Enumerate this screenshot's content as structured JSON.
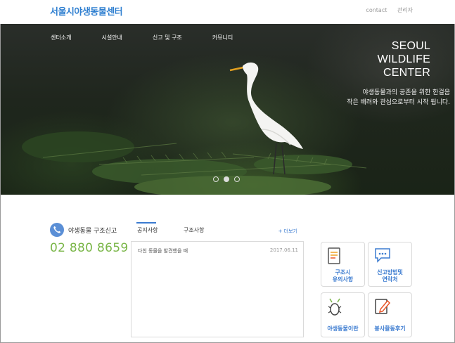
{
  "site": {
    "logo": "서울시야생동물센터"
  },
  "top_links": [
    "contact",
    "관리자"
  ],
  "nav": [
    "센터소개",
    "시설안내",
    "신고 및 구조",
    "커뮤니티"
  ],
  "hero": {
    "title_lines": [
      "SEOUL",
      "WILDLIFE",
      "CENTER"
    ],
    "subtitle_lines": [
      "야생동물과의 공존을 위한 한걸음",
      "작은 배려와 관심으로부터 시작 됩니다."
    ],
    "slides": {
      "count": 3,
      "active": 2
    }
  },
  "hotline": {
    "label": "야생동물 구조신고",
    "number": "02 880 8659",
    "icon": "phone-icon"
  },
  "board": {
    "tabs": [
      "공지사항",
      "구조사항"
    ],
    "active_tab": "공지사항",
    "more_label": "+ 더보기",
    "rows": [
      {
        "title": "다친 동물을 발견했을 때",
        "date": "2017.06.11"
      }
    ]
  },
  "quick_cards": [
    {
      "label": "구조시 유의사항",
      "icon": "document-icon"
    },
    {
      "label": "신고방법및 연락처",
      "icon": "chat-bubble-icon"
    },
    {
      "label": "야생동물이란",
      "icon": "bug-icon"
    },
    {
      "label": "봉사활동후기",
      "icon": "pencil-icon"
    }
  ],
  "colors": {
    "brand": "#2f7fd0",
    "accent_green": "#7ab648",
    "link_blue": "#3b7bd0"
  }
}
